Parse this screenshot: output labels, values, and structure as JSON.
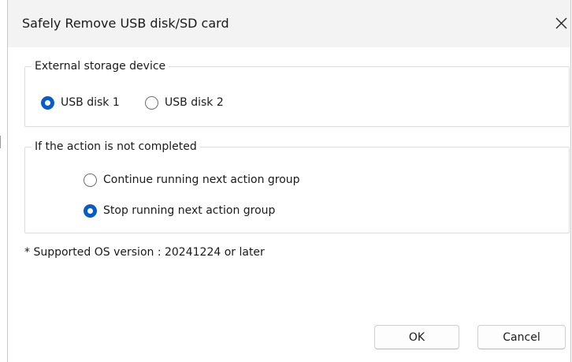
{
  "window": {
    "title": "Safely Remove USB disk/SD card"
  },
  "storage_group": {
    "legend": "External storage device",
    "options": [
      {
        "label": "USB disk 1",
        "selected": true
      },
      {
        "label": "USB disk 2",
        "selected": false
      }
    ]
  },
  "action_group": {
    "legend": "If the action is not completed",
    "options": [
      {
        "label": "Continue running next action group",
        "selected": false
      },
      {
        "label": "Stop running next action group",
        "selected": true
      }
    ]
  },
  "note": "* Supported OS version : 20241224 or later",
  "buttons": {
    "ok": "OK",
    "cancel": "Cancel"
  },
  "colors": {
    "accent": "#0a5cc2",
    "titlebar": "#f3f3f3"
  },
  "icons": {
    "close": "close-icon"
  }
}
